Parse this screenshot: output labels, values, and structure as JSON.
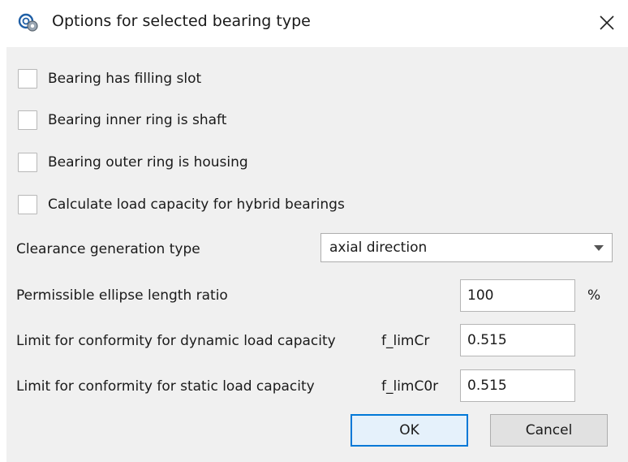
{
  "window": {
    "title": "Options for selected bearing type",
    "icon": "bearing-app-icon",
    "close_icon": "close-icon"
  },
  "checkboxes": [
    {
      "label": "Bearing has filling slot",
      "checked": false
    },
    {
      "label": "Bearing inner ring is shaft",
      "checked": false
    },
    {
      "label": "Bearing outer ring is housing",
      "checked": false
    },
    {
      "label": "Calculate load capacity for hybrid bearings",
      "checked": false
    }
  ],
  "clearance": {
    "label": "Clearance generation type",
    "selected": "axial direction"
  },
  "ellipse": {
    "label": "Permissible ellipse length ratio",
    "value": "100",
    "unit": "%"
  },
  "dynamic": {
    "label": "Limit for conformity for dynamic load capacity",
    "symbol": "f_limCr",
    "value": "0.515"
  },
  "static": {
    "label": "Limit for conformity for static load capacity",
    "symbol": "f_limC0r",
    "value": "0.515"
  },
  "buttons": {
    "ok": "OK",
    "cancel": "Cancel"
  },
  "colors": {
    "dialog_bg": "#f0f0f0",
    "default_button_border": "#0078d7"
  }
}
